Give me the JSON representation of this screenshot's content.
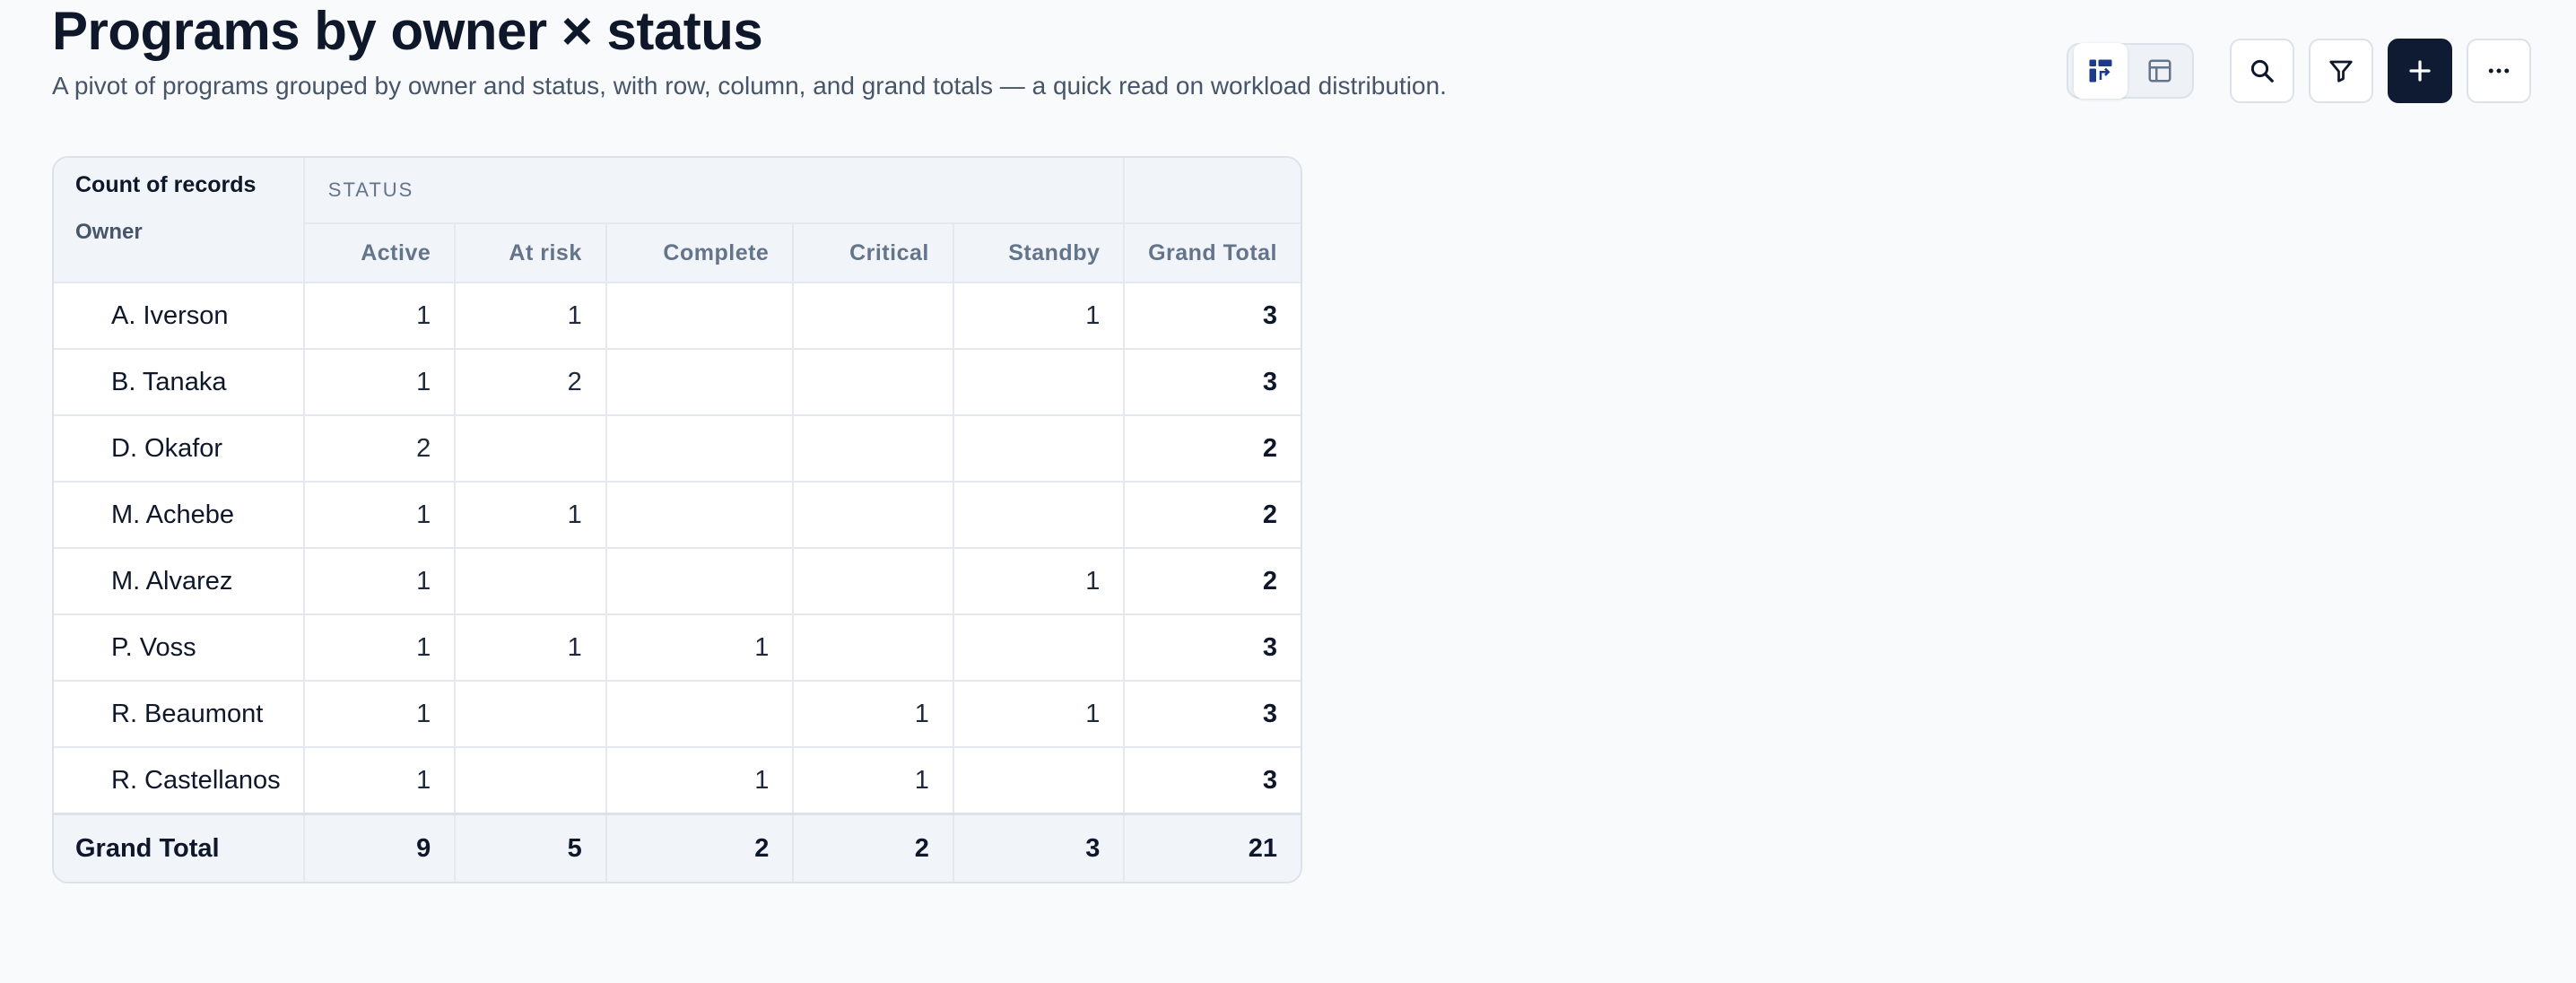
{
  "header": {
    "title": "Programs by owner × status",
    "subtitle": "A pivot of programs grouped by owner and status, with row, column, and grand totals — a quick read on workload distribution."
  },
  "toolbar": {
    "view_toggle": [
      {
        "icon": "pivot-icon",
        "active": true
      },
      {
        "icon": "table-icon",
        "active": false
      }
    ],
    "buttons": [
      {
        "icon": "search-icon"
      },
      {
        "icon": "filter-icon"
      },
      {
        "icon": "plus-icon",
        "primary": true
      },
      {
        "icon": "more-icon"
      }
    ]
  },
  "pivot": {
    "corner_title": "Count of records",
    "row_dimension": "Owner",
    "column_dimension": "STATUS",
    "columns": [
      "Active",
      "At risk",
      "Complete",
      "Critical",
      "Standby"
    ],
    "grand_total_label": "Grand Total",
    "rows": [
      {
        "owner": "A. Iverson",
        "cells": [
          "1",
          "1",
          "",
          "",
          "1"
        ],
        "total": "3"
      },
      {
        "owner": "B. Tanaka",
        "cells": [
          "1",
          "2",
          "",
          "",
          ""
        ],
        "total": "3"
      },
      {
        "owner": "D. Okafor",
        "cells": [
          "2",
          "",
          "",
          "",
          ""
        ],
        "total": "2"
      },
      {
        "owner": "M. Achebe",
        "cells": [
          "1",
          "1",
          "",
          "",
          ""
        ],
        "total": "2"
      },
      {
        "owner": "M. Alvarez",
        "cells": [
          "1",
          "",
          "",
          "",
          "1"
        ],
        "total": "2"
      },
      {
        "owner": "P. Voss",
        "cells": [
          "1",
          "1",
          "1",
          "",
          ""
        ],
        "total": "3"
      },
      {
        "owner": "R. Beaumont",
        "cells": [
          "1",
          "",
          "",
          "1",
          "1"
        ],
        "total": "3"
      },
      {
        "owner": "R. Castellanos",
        "cells": [
          "1",
          "",
          "1",
          "1",
          ""
        ],
        "total": "3"
      }
    ],
    "totals": {
      "label": "Grand Total",
      "cells": [
        "9",
        "5",
        "2",
        "2",
        "3"
      ],
      "total": "21"
    }
  },
  "colors": {
    "primary_button": "#0f1b33",
    "header_bg": "#f1f5f9",
    "border": "#dbe2ea"
  }
}
